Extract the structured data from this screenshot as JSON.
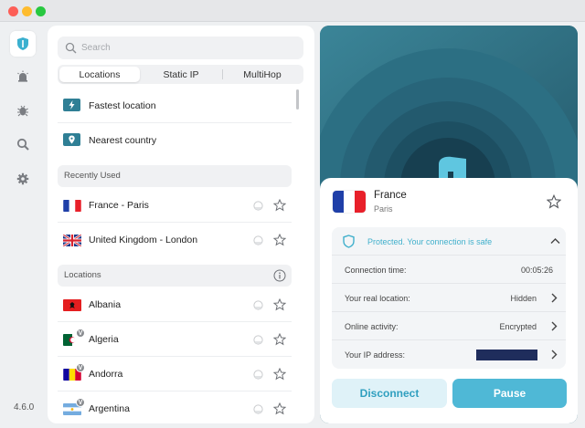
{
  "window": {
    "controls": [
      "close",
      "minimize",
      "zoom"
    ]
  },
  "rail": {
    "items": [
      {
        "name": "shield-icon",
        "active": true
      },
      {
        "name": "alert-icon",
        "active": false
      },
      {
        "name": "bug-icon",
        "active": false
      },
      {
        "name": "search-zoom-icon",
        "active": false
      },
      {
        "name": "gear-icon",
        "active": false
      }
    ],
    "version": "4.6.0"
  },
  "search": {
    "placeholder": "Search",
    "value": ""
  },
  "tabs": [
    {
      "label": "Locations",
      "active": true
    },
    {
      "label": "Static IP",
      "active": false
    },
    {
      "label": "MultiHop",
      "active": false
    }
  ],
  "quick": [
    {
      "label": "Fastest location",
      "icon": "bolt-icon"
    },
    {
      "label": "Nearest country",
      "icon": "pin-icon"
    }
  ],
  "recent": {
    "title": "Recently Used",
    "items": [
      {
        "label": "France - Paris",
        "flag": "fr"
      },
      {
        "label": "United Kingdom - London",
        "flag": "gb"
      }
    ]
  },
  "locations": {
    "title": "Locations",
    "items": [
      {
        "label": "Albania",
        "flag": "al",
        "virtual": false
      },
      {
        "label": "Algeria",
        "flag": "dz",
        "virtual": true
      },
      {
        "label": "Andorra",
        "flag": "ad",
        "virtual": true
      },
      {
        "label": "Argentina",
        "flag": "ar",
        "virtual": true
      }
    ],
    "virtual_badge": "V"
  },
  "connection": {
    "country": "France",
    "city": "Paris",
    "status_text": "Protected. Your connection is safe",
    "rows": [
      {
        "key": "Connection time:",
        "value": "00:05:26"
      },
      {
        "key": "Your real location:",
        "value": "Hidden"
      },
      {
        "key": "Online activity:",
        "value": "Encrypted"
      },
      {
        "key": "Your IP address:",
        "value": ""
      }
    ],
    "disconnect_label": "Disconnect",
    "pause_label": "Pause"
  },
  "colors": {
    "accent": "#4fb8d6",
    "status_text": "#41b0cc",
    "map_background": "#2f6b7e"
  }
}
